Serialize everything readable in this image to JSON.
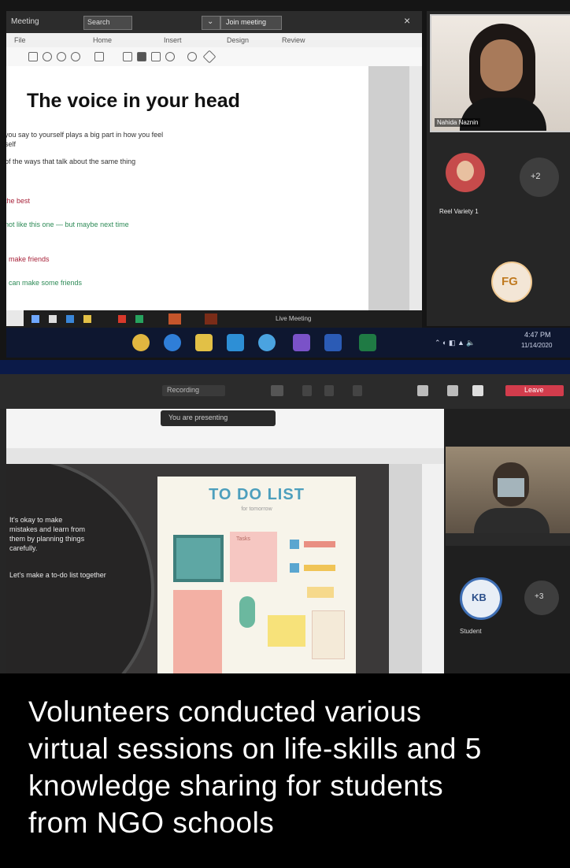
{
  "top_screen": {
    "window": {
      "title": "Meeting",
      "search": "Search",
      "action_button": "Join meeting"
    },
    "menu": [
      "File",
      "Home",
      "Insert",
      "Design",
      "Review"
    ],
    "document": {
      "heading": "The voice in your head",
      "lines": [
        {
          "text": "you say to yourself plays a big part in how you feel",
          "color": "#333333"
        },
        {
          "text": "self",
          "color": "#333333"
        },
        {
          "text": "of the ways that talk about the same thing",
          "color": "#333333"
        },
        {
          "text": "the best",
          "color": "#a8233a"
        },
        {
          "text": "not like this one — but maybe next time",
          "color": "#2e8b57"
        },
        {
          "text": "I make friends",
          "color": "#a8233a"
        },
        {
          "text": "I can make some friends",
          "color": "#2e8b57"
        }
      ]
    },
    "participants": {
      "main_name": "Nahida Naznin",
      "second_name": "Reel Variety 1",
      "initials": "FG",
      "more_count": "+2"
    },
    "taskbar": {
      "time": "4:47 PM",
      "date": "11/14/2020",
      "status": "Live Meeting"
    }
  },
  "bottom_screen": {
    "toolbar": {
      "center_label": "Recording",
      "leave_label": "Leave"
    },
    "share_banner": "You are presenting",
    "slide_text": [
      "It's okay to make",
      "mistakes and learn from",
      "them by planning things",
      "carefully.",
      "Let's make a to-do list together"
    ],
    "todo": {
      "title": "TO DO LIST",
      "subtitle": "for tomorrow",
      "note": "Tasks"
    },
    "participants": {
      "initials": "KB",
      "more_count": "+3",
      "name": "Student"
    }
  },
  "caption": {
    "lines": [
      "Volunteers conducted various",
      "virtual sessions on life-skills and 5",
      "knowledge sharing for students",
      "from NGO schools"
    ]
  },
  "colors": {
    "caption_bg": "#000000",
    "divider": "#0b1a48",
    "taskbar": "#0e1730",
    "accent_red": "#d23c4c",
    "todo_title": "#4d9fbd"
  }
}
